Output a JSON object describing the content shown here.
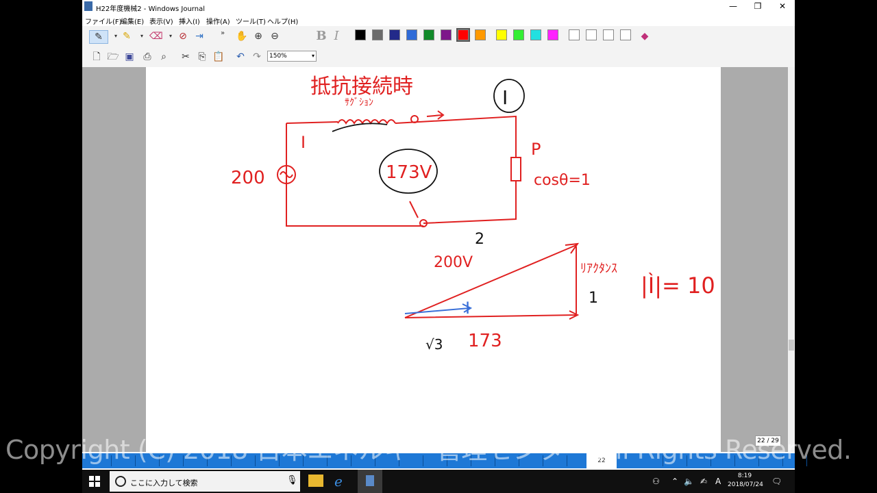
{
  "window": {
    "title": "H22年度機械2 - Windows Journal",
    "minimize_symbol": "—",
    "restore_symbol": "❐",
    "close_symbol": "✕"
  },
  "menu": [
    "ファイル(F)",
    "編集(E)",
    "表示(V)",
    "挿入(I)",
    "操作(A)",
    "ツール(T)",
    "ヘルプ(H)"
  ],
  "toolbar": {
    "bold": "B",
    "italic": "I",
    "more": "»",
    "pen_colors": [
      "#000000",
      "#6b6b6b",
      "#232a8a",
      "#2f6bd8",
      "#118a2a",
      "#7d168a",
      "#ff0000",
      "#ff9900",
      "#ffff00",
      "#33ee33",
      "#22e0e0",
      "#ff22ff",
      "#ffffff",
      "#ffffff",
      "#ffffff",
      "#ffffff"
    ],
    "selected_color": "#ff0000",
    "zoom_value": "150%"
  },
  "note": {
    "heading": "抵抗接続時",
    "inductor_label": "ｻｸﾞｼｮﾝ",
    "current_label": "I",
    "source_label": "200",
    "voltmeter_label": "173V",
    "load_label": "P",
    "pf_label": "cosθ=1",
    "tri_top": "2",
    "tri_hyp": "200V",
    "tri_vert_label": "ﾘｱｸﾀﾝｽ",
    "tri_vert_value": "1",
    "tri_current": "I",
    "tri_base": "173",
    "tri_root": "√3",
    "equation": "|Ì|= 10"
  },
  "page_indicator": "22 / 29",
  "pagebar_current": "22",
  "watermark": "Copyright (C) 2018 日本エネルギー管理センター All Rights Reserved.",
  "taskbar": {
    "search_placeholder": "ここに入力して検索",
    "time": "8:19",
    "date": "2018/07/24",
    "ime": "A"
  }
}
